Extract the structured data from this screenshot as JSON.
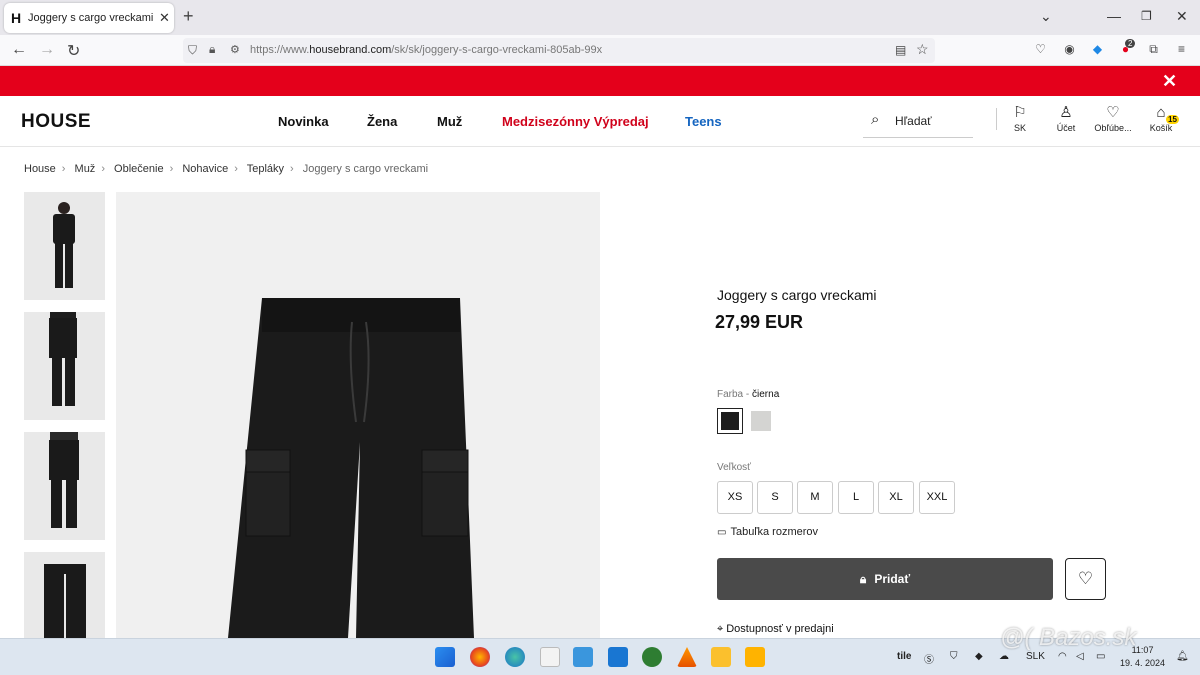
{
  "browser": {
    "tab_title": "Joggery s cargo vreckami Farba",
    "tab_favicon": "H",
    "url_prefix": "https://www.",
    "url_domain": "housebrand.com",
    "url_path": "/sk/sk/joggery-s-cargo-vreckami-805ab-99x",
    "extension_badge": "2"
  },
  "header": {
    "logo": "HOUSE",
    "menu": [
      "Novinka",
      "Žena",
      "Muž",
      "Medzisezónny Výpredaj",
      "Teens"
    ],
    "menu_colors": {
      "sale": "#d0021b",
      "teens": "#1565c0"
    },
    "search_placeholder": "Hľadať",
    "icons": [
      {
        "label": "SK",
        "icon": "flag-icon"
      },
      {
        "label": "Účet",
        "icon": "user-icon"
      },
      {
        "label": "Obľúbe...",
        "icon": "heart-icon"
      },
      {
        "label": "Košík",
        "icon": "bag-icon"
      }
    ],
    "cart_count": "15"
  },
  "breadcrumb": [
    "House",
    "Muž",
    "Oblečenie",
    "Nohavice",
    "Tepláky",
    "Joggery s cargo vreckami"
  ],
  "product": {
    "name": "Joggery s cargo vreckami",
    "price": "27,99 EUR",
    "color_label": "Farba - ",
    "color_value": "čierna",
    "swatches": [
      "#1c1c1c",
      "#d4d4d2"
    ],
    "size_label": "Veľkosť",
    "sizes": [
      "XS",
      "S",
      "M",
      "L",
      "XL",
      "XXL"
    ],
    "size_chart": "Tabuľka rozmerov",
    "add_button": "Pridať",
    "availability": "Dostupnosť v predajni"
  },
  "taskbar": {
    "tray_text": "tile",
    "language": "SLK",
    "time": "11:07",
    "date": "19. 4. 2024"
  },
  "watermark": "@( Bazos.sk"
}
